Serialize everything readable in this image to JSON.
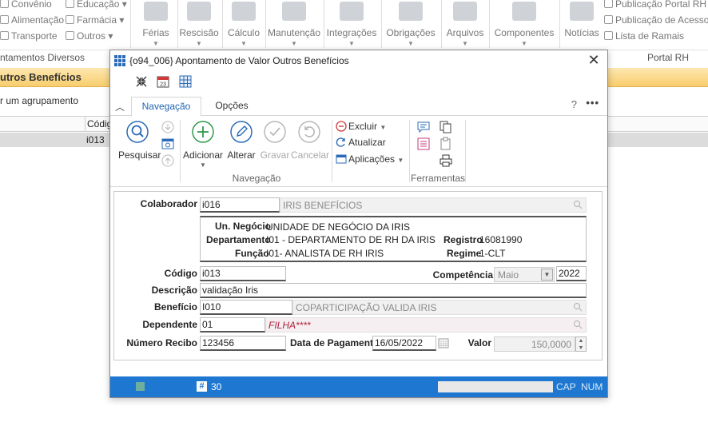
{
  "background": {
    "ribbon_small_items": [
      {
        "label": "Convênio",
        "dropdown": false
      },
      {
        "label": "Alimentação",
        "dropdown": false
      },
      {
        "label": "Transporte",
        "dropdown": false
      },
      {
        "label": "Educação",
        "dropdown": true
      },
      {
        "label": "Farmácia",
        "dropdown": true
      },
      {
        "label": "Outros",
        "dropdown": true
      }
    ],
    "ribbon_big_buttons": [
      {
        "label": "Férias",
        "dropdown": true
      },
      {
        "label": "Rescisão",
        "dropdown": true
      },
      {
        "label": "Cálculo",
        "dropdown": true
      },
      {
        "label": "Manutenção",
        "dropdown": true
      },
      {
        "label": "Integrações",
        "dropdown": true
      },
      {
        "label": "Obrigações",
        "dropdown": true
      },
      {
        "label": "Arquivos",
        "dropdown": true
      },
      {
        "label": "Componentes",
        "dropdown": true
      },
      {
        "label": "Notícias",
        "dropdown": false
      }
    ],
    "ribbon_right_items": [
      {
        "label": "Publicação Portal RH"
      },
      {
        "label": "Publicação de Acesso"
      },
      {
        "label": "Lista de Ramais"
      }
    ],
    "group_left_label": "ntamentos Diversos",
    "group_right_label": "Portal RH",
    "window_title": "utros Benefícios",
    "grouping_hint": "r um agrupamento",
    "grid_header": "Códig",
    "grid_row_value": "i013"
  },
  "dialog": {
    "title": "{o94_006}  Apontamento de Valor Outros Benefícios",
    "close_symbol": "✕",
    "tabs": [
      {
        "label": "Navegação",
        "active": true
      },
      {
        "label": "Opções",
        "active": false
      }
    ],
    "help_symbol": "?",
    "more_symbol": "•••",
    "collapse_symbol": "︿",
    "ribbon": {
      "pesquisar": "Pesquisar",
      "adicionar": "Adicionar",
      "alterar": "Alterar",
      "gravar": "Gravar",
      "cancelar": "Cancelar",
      "excluir": "Excluir",
      "atualizar": "Atualizar",
      "aplicacoes": "Aplicações",
      "group_navegacao": "Navegação",
      "group_ferramentas": "Ferramentas"
    },
    "form": {
      "colaborador_label": "Colaborador",
      "colaborador_code": "i016",
      "colaborador_name": "IRIS BENEFÍCIOS",
      "un_negocio_label": "Un. Negócio",
      "un_negocio_value": "UNIDADE DE NEGÓCIO DA IRIS",
      "departamento_label": "Departamento",
      "departamento_value": "I01 - DEPARTAMENTO DE RH DA IRIS",
      "funcao_label": "Função",
      "funcao_value": "I01- ANALISTA DE RH IRIS",
      "registro_label": "Registro",
      "registro_value": "16081990",
      "regime_label": "Regime",
      "regime_value": "1-CLT",
      "codigo_label": "Código",
      "codigo_value": "i013",
      "competencia_label": "Competência",
      "competencia_month": "Maio",
      "competencia_year": "2022",
      "descricao_label": "Descrição",
      "descricao_value": "validação Iris",
      "beneficio_label": "Benefício",
      "beneficio_code": "I010",
      "beneficio_name": "COPARTICIPAÇÃO VALIDA IRIS",
      "dependente_label": "Dependente",
      "dependente_code": "01",
      "dependente_name": "FILHA****",
      "numero_recibo_label": "Número Recibo",
      "numero_recibo_value": "123456",
      "data_pagamento_label": "Data de Pagamento",
      "data_pagamento_value": "16/05/2022",
      "valor_label": "Valor",
      "valor_value": "150,0000"
    },
    "status": {
      "hash_symbol": "#",
      "count": "30",
      "cap": "CAP",
      "num": "NUM"
    }
  },
  "colors": {
    "accent_blue": "#1e78d2",
    "tab_active_text": "#1e64b4",
    "title_bar_gold": "#f8cd6d",
    "dependente_text": "#b0203a"
  }
}
